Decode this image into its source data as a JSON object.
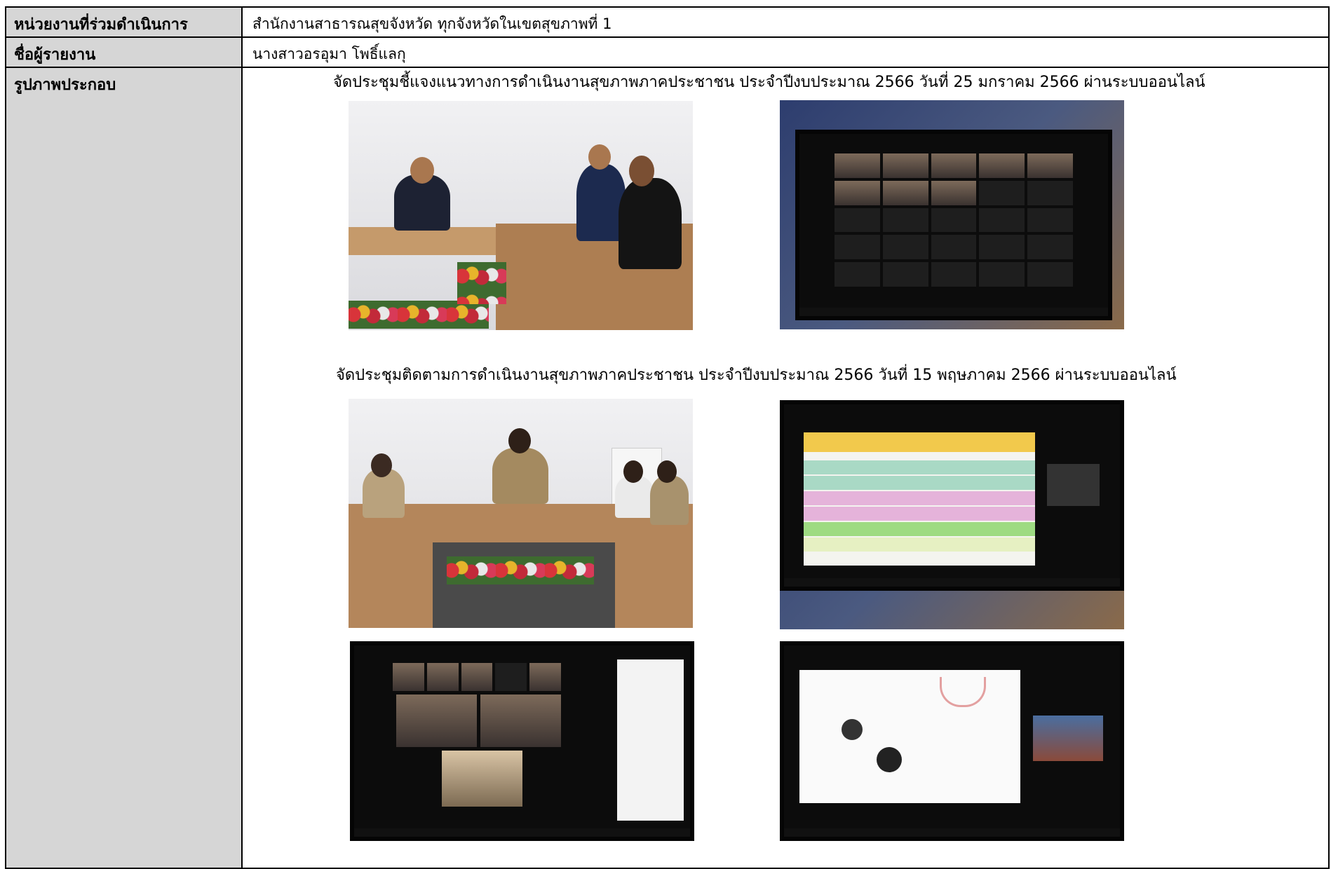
{
  "rows": {
    "agency": {
      "label": "หน่วยงานที่ร่วมดำเนินการ",
      "value": "สำนักงานสาธารณสุขจังหวัด ทุกจังหวัดในเขตสุขภาพที่ 1"
    },
    "reporter": {
      "label": "ชื่อผู้รายงาน",
      "value": "นางสาวอรอุมา โพธิ์แลกุ"
    },
    "photos": {
      "label": "รูปภาพประกอบ",
      "caption_1": "จัดประชุมชี้แจงแนวทางการดำเนินงานสุขภาพภาคประชาชน ประจำปีงบประมาณ 2566 วันที่ 25 มกราคม 2566 ผ่านระบบออนไลน์",
      "caption_2": "จัดประชุมติดตามการดำเนินงานสุขภาพภาคประชาชน ประจำปีงบประมาณ 2566 วันที่ 15 พฤษภาคม 2566 ผ่านระบบออนไลน์"
    }
  },
  "colors": {
    "label_background": "#d6d6d6",
    "border": "#000000"
  }
}
